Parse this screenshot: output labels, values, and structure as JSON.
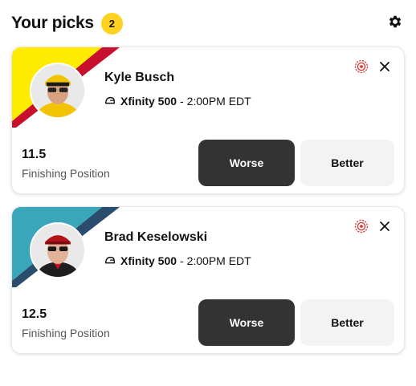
{
  "header": {
    "title": "Your picks",
    "count": "2",
    "settings_icon": "gear-icon"
  },
  "colors": {
    "badge": "#ffd21f",
    "worse_button": "#333333",
    "better_button": "#f3f3f3",
    "target_icon": "#d9393a"
  },
  "picks": [
    {
      "driver": "Kyle Busch",
      "race": "Xfinity 500",
      "time": "- 2:00PM EDT",
      "line": "11.5",
      "stat": "Finishing Position",
      "worse_label": "Worse",
      "better_label": "Better",
      "stripe_colors": [
        "#ffeb00",
        "#c8102e"
      ]
    },
    {
      "driver": "Brad Keselowski",
      "race": "Xfinity 500",
      "time": "- 2:00PM EDT",
      "line": "12.5",
      "stat": "Finishing Position",
      "worse_label": "Worse",
      "better_label": "Better",
      "stripe_colors": [
        "#3aa6b9",
        "#2a4d6e"
      ]
    }
  ]
}
